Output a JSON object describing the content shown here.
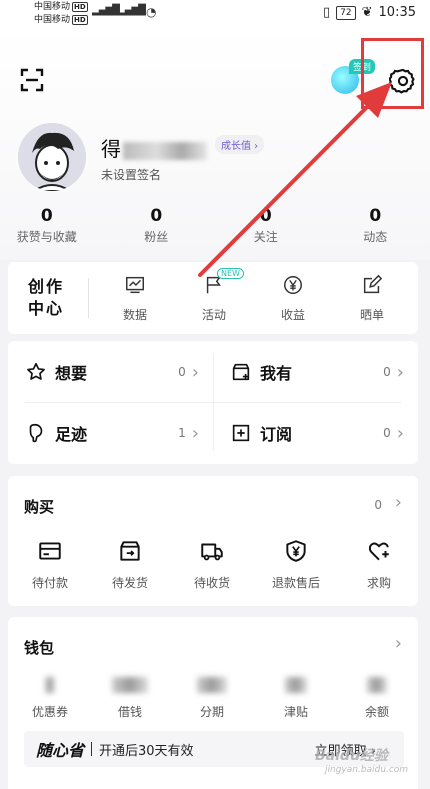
{
  "status_bar": {
    "carrier1": "中国移动",
    "carrier2": "中国移动",
    "hd": "HD",
    "network": "4G",
    "battery": "72",
    "time": "10:35"
  },
  "header": {
    "vip_tag": "签到",
    "username_prefix": "得",
    "growth_badge": "成长值 ›",
    "signature": "未设置签名"
  },
  "stats": [
    {
      "value": "0",
      "label": "获赞与收藏"
    },
    {
      "value": "0",
      "label": "粉丝"
    },
    {
      "value": "0",
      "label": "关注"
    },
    {
      "value": "0",
      "label": "动态"
    }
  ],
  "creator": {
    "title": "创作中心",
    "items": [
      {
        "label": "数据",
        "icon": "chart-icon"
      },
      {
        "label": "活动",
        "icon": "flag-icon",
        "badge": "NEW"
      },
      {
        "label": "收益",
        "icon": "yen-icon"
      },
      {
        "label": "晒单",
        "icon": "edit-icon"
      }
    ]
  },
  "wants": [
    {
      "label": "想要",
      "count": "0",
      "icon": "star-icon"
    },
    {
      "label": "我有",
      "count": "0",
      "icon": "box-add-icon"
    },
    {
      "label": "足迹",
      "count": "1",
      "icon": "footprint-icon"
    },
    {
      "label": "订阅",
      "count": "0",
      "icon": "plus-square-icon"
    }
  ],
  "buy": {
    "title": "购买",
    "count": "0",
    "items": [
      {
        "label": "待付款",
        "icon": "wallet-icon"
      },
      {
        "label": "待发货",
        "icon": "package-icon"
      },
      {
        "label": "待收货",
        "icon": "truck-icon"
      },
      {
        "label": "退款售后",
        "icon": "shield-yen-icon"
      },
      {
        "label": "求购",
        "icon": "heart-plus-icon"
      }
    ]
  },
  "wallet": {
    "title": "钱包",
    "items": [
      {
        "label": "优惠券"
      },
      {
        "label": "借钱"
      },
      {
        "label": "分期"
      },
      {
        "label": "津贴"
      },
      {
        "label": "余额"
      }
    ],
    "promo_brand": "随心省",
    "promo_text": "开通后30天有效",
    "promo_cta": "立即领取 ›"
  },
  "watermark": "Baidu经验",
  "watermark_sub": "jingyan.baidu.com",
  "colors": {
    "annotation": "#e23b3b",
    "accent_teal": "#2abfb0",
    "growth_text": "#6a5acd"
  }
}
